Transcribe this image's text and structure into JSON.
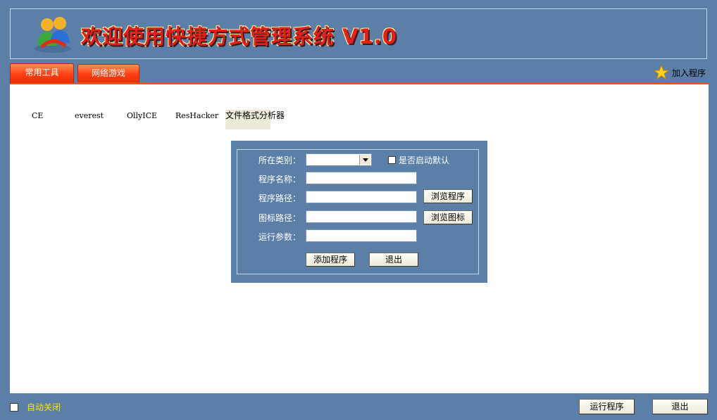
{
  "header": {
    "title": "欢迎使用快捷方式管理系统 V1.0",
    "logo_icon": "messenger-people-icon"
  },
  "tabs": [
    {
      "label": "常用工具",
      "active": true
    },
    {
      "label": "网络游戏",
      "active": false
    }
  ],
  "toolbar": {
    "add_program_label": "加入程序",
    "add_program_icon": "star-icon"
  },
  "shortcuts": [
    "CE",
    "everest",
    "OllyICE",
    "ResHacker",
    "文件格式分析器"
  ],
  "form": {
    "category_label": "所在类别：",
    "category_value": "",
    "default_start_label": "是否启动默认",
    "name_label": "程序名称：",
    "name_value": "",
    "path_label": "程序路径：",
    "path_value": "",
    "browse_program_label": "浏览程序",
    "icon_path_label": "图标路径：",
    "icon_path_value": "",
    "browse_icon_label": "浏览图标",
    "params_label": "运行参数：",
    "params_value": "",
    "add_button_label": "添加程序",
    "exit_button_label": "退出"
  },
  "footer": {
    "auto_close_label": "自动关闭",
    "run_button_label": "运行程序",
    "exit_button_label": "退出"
  },
  "colors": {
    "background": "#5b7fa6",
    "tab_orange": "#ff3f12",
    "title_red": "#e02019",
    "auto_close_yellow": "#ffe900"
  }
}
